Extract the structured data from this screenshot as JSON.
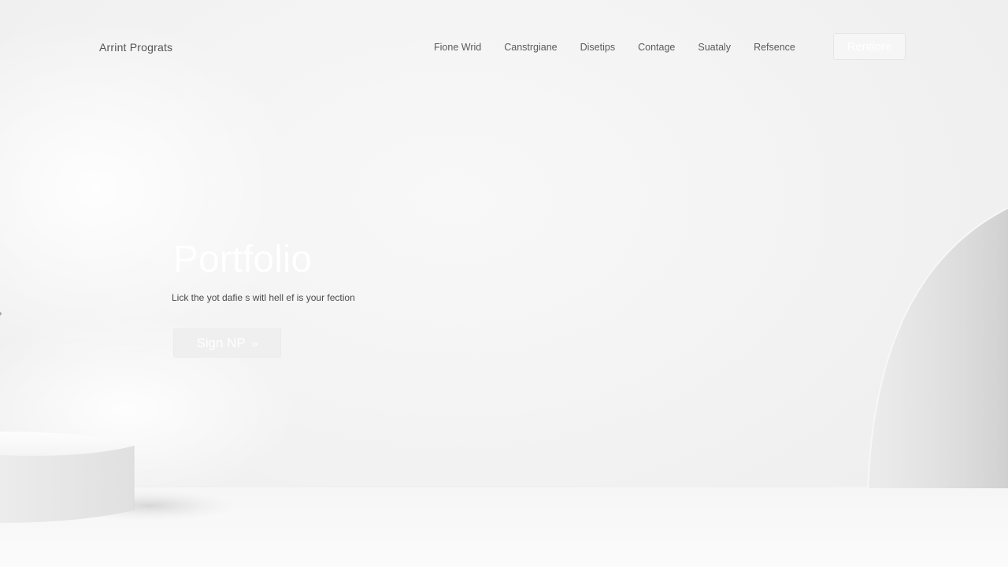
{
  "header": {
    "brand": "Arrint Prograts",
    "nav": [
      {
        "label": "Fione Wrid"
      },
      {
        "label": "Canstrgiane"
      },
      {
        "label": "Disetips"
      },
      {
        "label": "Contage"
      },
      {
        "label": "Suataly"
      },
      {
        "label": "Refsence"
      }
    ],
    "cta_label": "Rentiore"
  },
  "hero": {
    "title": "Portfolio",
    "subtitle": "Lick the yot dafie s witl hell ef is your fection",
    "button_label": "Sign NP",
    "button_icon": "double-chevron-right-icon"
  },
  "side_control": {
    "icon": "chevron-right-icon"
  },
  "colors": {
    "background": "#f3f3f3",
    "nav_text": "#5a5a5a",
    "hero_text": "#ffffff",
    "subtitle_text": "#4a4a4a"
  }
}
